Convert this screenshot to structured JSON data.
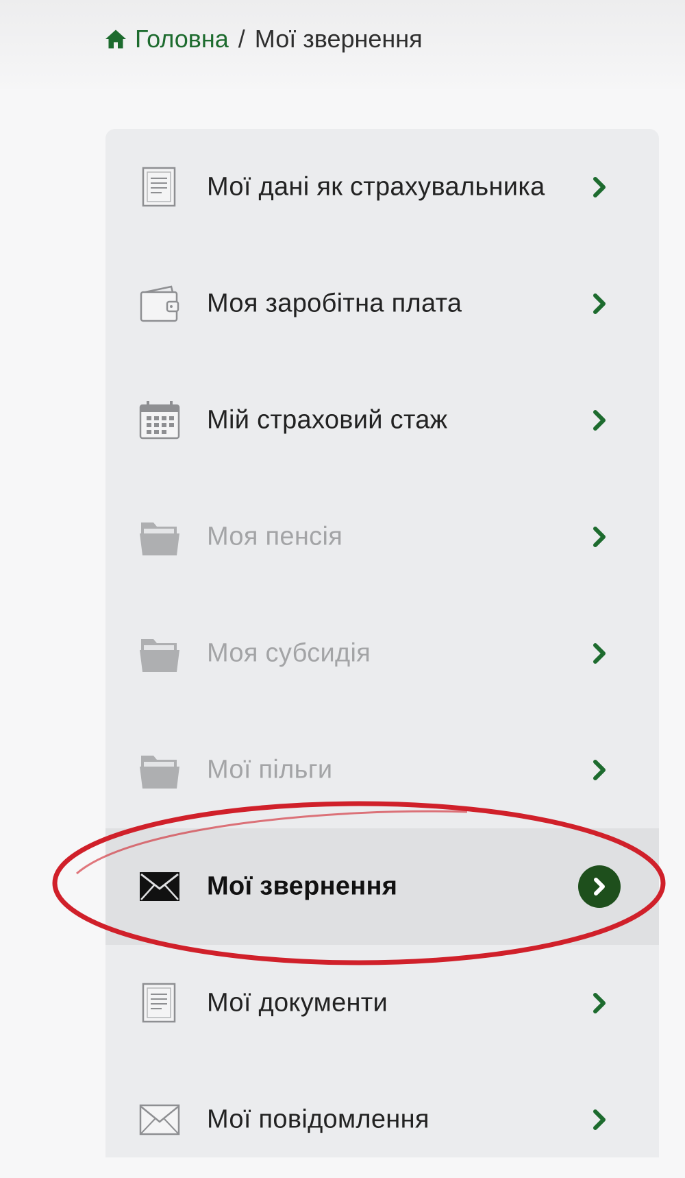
{
  "breadcrumb": {
    "home_label": "Головна",
    "separator": "/",
    "current": "Мої звернення"
  },
  "menu": {
    "items": [
      {
        "label": "Мої дані як страхувальника",
        "icon": "document-icon",
        "state": "normal"
      },
      {
        "label": "Моя заробітна плата",
        "icon": "wallet-icon",
        "state": "normal"
      },
      {
        "label": "Мій страховий стаж",
        "icon": "calendar-icon",
        "state": "normal"
      },
      {
        "label": "Моя пенсія",
        "icon": "folder-icon",
        "state": "disabled"
      },
      {
        "label": "Моя субсидія",
        "icon": "folder-icon",
        "state": "disabled"
      },
      {
        "label": "Мої пільги",
        "icon": "folder-icon",
        "state": "disabled"
      },
      {
        "label": "Мої звернення",
        "icon": "envelope-icon",
        "state": "active"
      },
      {
        "label": "Мої документи",
        "icon": "document-icon",
        "state": "normal"
      },
      {
        "label": "Мої повідомлення",
        "icon": "envelope-outline-icon",
        "state": "normal"
      }
    ]
  },
  "colors": {
    "accent_green": "#1d6b2e",
    "active_chevron_bg": "#1e4f1c",
    "annotation_red": "#d0202a"
  }
}
